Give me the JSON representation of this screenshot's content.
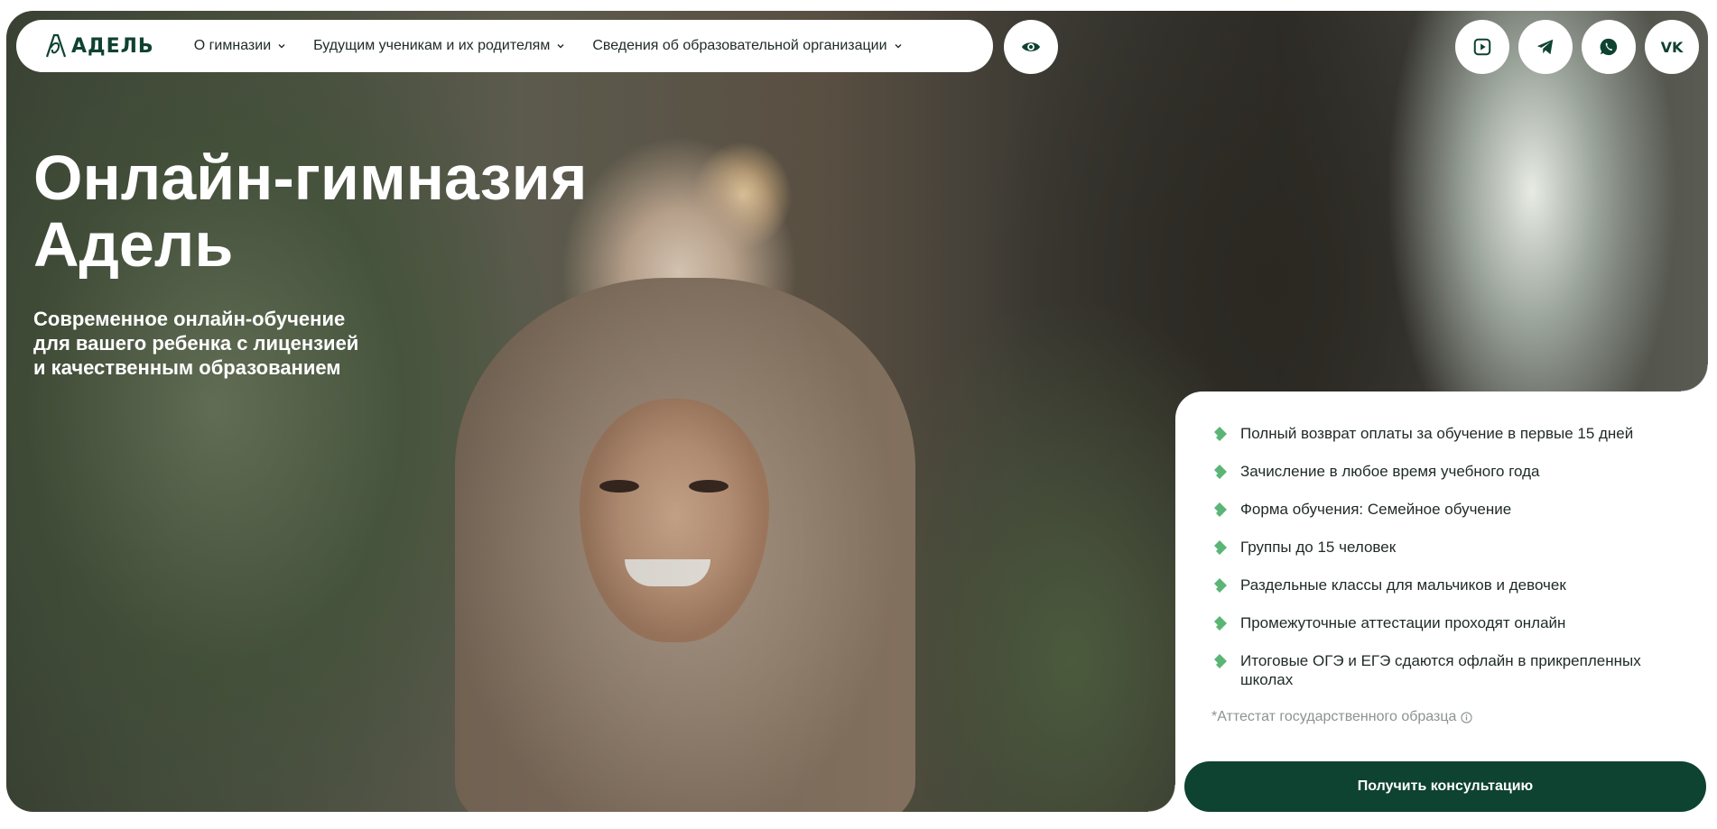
{
  "header": {
    "logo_text": "АДЕЛЬ",
    "nav_items": [
      {
        "label": "О гимназии"
      },
      {
        "label": "Будущим ученикам и их родителям"
      },
      {
        "label": "Сведения об образовательной организации"
      }
    ],
    "accessibility_icon": "eye-icon",
    "social_icons": [
      "video-icon",
      "telegram-icon",
      "whatsapp-icon",
      "vk-icon"
    ],
    "vk_label": "VK"
  },
  "hero": {
    "title_line1": "Онлайн-гимназия",
    "title_line2": "Адель",
    "subtitle_line1": "Современное онлайн-обучение",
    "subtitle_line2": "для вашего ребенка с лицензией",
    "subtitle_line3": "и качественным образованием"
  },
  "info_card": {
    "features": [
      "Полный возврат оплаты за обучение в первые 15 дней",
      "Зачисление в любое время учебного года",
      "Форма обучения: Семейное обучение",
      "Группы до 15 человек",
      "Раздельные классы для мальчиков и девочек",
      "Промежуточные аттестации проходят онлайн",
      "Итоговые ОГЭ и ЕГЭ сдаются офлайн в прикрепленных школах"
    ],
    "note": "*Аттестат государственного образца",
    "cta_label": "Получить консультацию"
  },
  "colors": {
    "brand": "#0e4231",
    "accent_check": "#5bb574",
    "text": "#1f2a25",
    "muted": "#8c938f"
  }
}
